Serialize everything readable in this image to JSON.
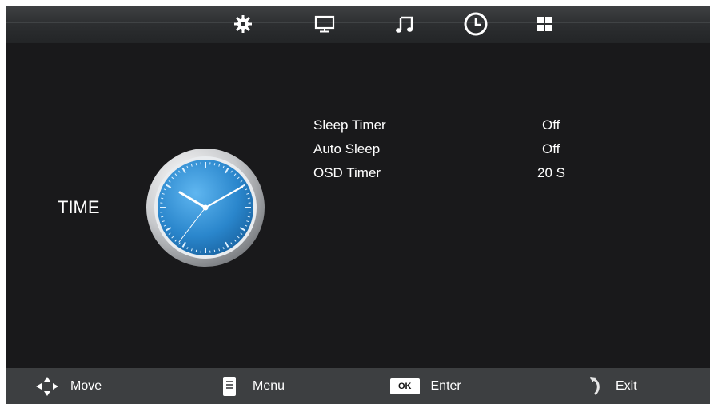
{
  "topbar": {
    "tabs": [
      {
        "icon": "gear-icon",
        "label": "Picture settings"
      },
      {
        "icon": "monitor-icon",
        "label": "Screen"
      },
      {
        "icon": "music-note-icon",
        "label": "Sound"
      },
      {
        "icon": "clock-icon",
        "label": "Time",
        "selected": true
      },
      {
        "icon": "grid-icon",
        "label": "Setup"
      }
    ]
  },
  "section": {
    "title": "TIME",
    "illustration": "clock-illustration"
  },
  "menu": {
    "items": [
      {
        "label": "Sleep Timer",
        "value": "Off"
      },
      {
        "label": "Auto Sleep",
        "value": "Off"
      },
      {
        "label": "OSD Timer",
        "value": "20 S"
      }
    ]
  },
  "footer": {
    "move": {
      "icon": "dpad-arrows-icon",
      "label": "Move"
    },
    "menu": {
      "icon": "menu-document-icon",
      "label": "Menu"
    },
    "enter": {
      "icon": "ok-button",
      "badge": "OK",
      "label": "Enter"
    },
    "exit": {
      "icon": "return-arrow-icon",
      "label": "Exit"
    }
  },
  "colors": {
    "background": "#19191b",
    "topbar": "#2c2e30",
    "footer": "#3d3f41",
    "text": "#ffffff",
    "clock_face": "#2f8fd6"
  }
}
